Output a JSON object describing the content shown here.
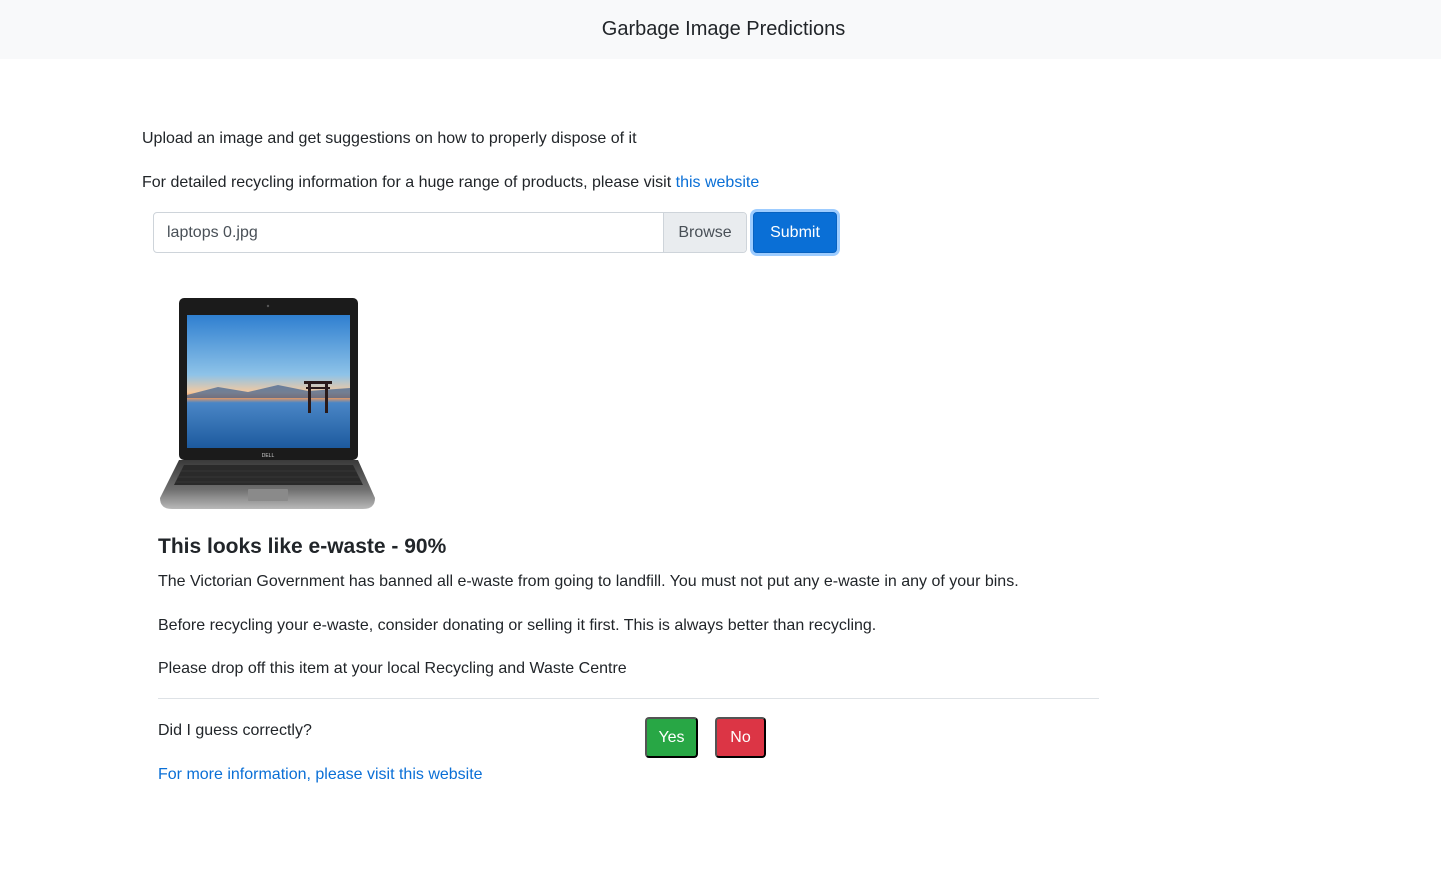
{
  "header": {
    "title": "Garbage Image Predictions"
  },
  "intro": {
    "line1": "Upload an image and get suggestions on how to properly dispose of it",
    "line2_prefix": "For detailed recycling information for a huge range of products, please visit ",
    "line2_link": "this website"
  },
  "upload": {
    "file_name": "laptops 0.jpg",
    "browse_label": "Browse",
    "submit_label": "Submit"
  },
  "image": {
    "icon": "laptop-image",
    "brand": "DELL"
  },
  "result": {
    "title": "This looks like e-waste - 90%",
    "para1": "The Victorian Government has banned all e-waste from going to landfill. You must not put any e-waste in any of your bins.",
    "para2": "Before recycling your e-waste, consider donating or selling it first. This is always better than recycling.",
    "para3": "Please drop off this item at your local Recycling and Waste Centre"
  },
  "feedback": {
    "question": "Did I guess correctly?",
    "yes_label": "Yes",
    "no_label": "No",
    "more_info_link": "For more information, please visit this website"
  },
  "colors": {
    "primary": "#0a6fd6",
    "success": "#28a745",
    "danger": "#dc3545",
    "navbar_bg": "#f8f9fa"
  }
}
